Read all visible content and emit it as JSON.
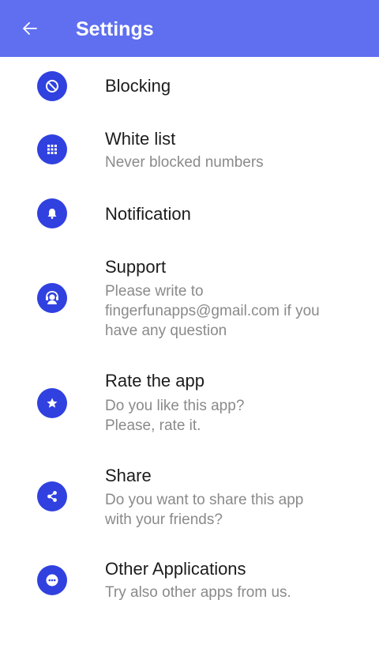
{
  "appbar": {
    "title": "Settings",
    "back_icon": "arrow-left-icon",
    "color": "#5f6ff0"
  },
  "accent_color": "#3041e0",
  "items": [
    {
      "title": "Blocking",
      "subtitle": "",
      "icon": "block-icon"
    },
    {
      "title": "White list",
      "subtitle": "Never blocked numbers",
      "icon": "dialpad-icon"
    },
    {
      "title": "Notification",
      "subtitle": "",
      "icon": "bell-icon"
    },
    {
      "title": "Support",
      "subtitle_lines": [
        "Please write to",
        "fingerfunapps@gmail.com if you",
        "have any question"
      ],
      "icon": "support-agent-icon"
    },
    {
      "title": "Rate the app",
      "subtitle_lines": [
        "Do you like this app?",
        "Please, rate it."
      ],
      "icon": "star-icon"
    },
    {
      "title": "Share",
      "subtitle_lines": [
        "Do you want to share this app",
        "with your friends?"
      ],
      "icon": "share-icon"
    },
    {
      "title": "Other Applications",
      "subtitle": "Try also other apps from us.",
      "icon": "more-icon"
    }
  ]
}
